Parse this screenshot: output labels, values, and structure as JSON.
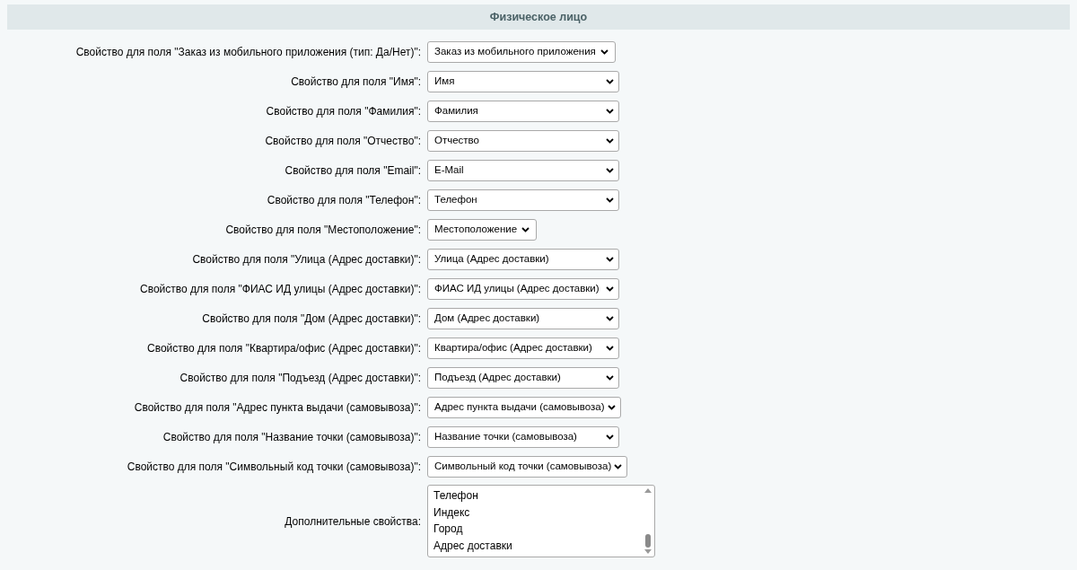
{
  "section": {
    "title": "Физическое лицо"
  },
  "fields": [
    {
      "label": "Свойство для поля \"Заказ из мобильного приложения (тип: Да/Нет)\":",
      "value": "Заказ из мобильного приложения",
      "kind": "fit"
    },
    {
      "label": "Свойство для поля \"Имя\":",
      "value": "Имя",
      "kind": "wide"
    },
    {
      "label": "Свойство для поля \"Фамилия\":",
      "value": "Фамилия",
      "kind": "wide"
    },
    {
      "label": "Свойство для поля \"Отчество\":",
      "value": "Отчество",
      "kind": "wide"
    },
    {
      "label": "Свойство для поля \"Email\":",
      "value": "E-Mail",
      "kind": "wide"
    },
    {
      "label": "Свойство для поля \"Телефон\":",
      "value": "Телефон",
      "kind": "wide"
    },
    {
      "label": "Свойство для поля \"Местоположение\":",
      "value": "Местоположение",
      "kind": "fit"
    },
    {
      "label": "Свойство для поля \"Улица (Адрес доставки)\":",
      "value": "Улица (Адрес доставки)",
      "kind": "wide"
    },
    {
      "label": "Свойство для поля \"ФИАС ИД улицы (Адрес доставки)\":",
      "value": "ФИАС ИД улицы (Адрес доставки)",
      "kind": "wide"
    },
    {
      "label": "Свойство для поля \"Дом (Адрес доставки)\":",
      "value": "Дом (Адрес доставки)",
      "kind": "wide"
    },
    {
      "label": "Свойство для поля \"Квартира/офис (Адрес доставки)\":",
      "value": "Квартира/офис (Адрес доставки)",
      "kind": "wide"
    },
    {
      "label": "Свойство для поля \"Подъезд (Адрес доставки)\":",
      "value": "Подъезд (Адрес доставки)",
      "kind": "wide"
    },
    {
      "label": "Свойство для поля \"Адрес пункта выдачи (самовывоза)\":",
      "value": "Адрес пункта выдачи (самовывоза)",
      "kind": "wide"
    },
    {
      "label": "Свойство для поля \"Название точки (самовывоза)\":",
      "value": "Название точки (самовывоза)",
      "kind": "wide"
    },
    {
      "label": "Свойство для поля \"Символьный код точки (самовывоза)\":",
      "value": "Символьный код точки (самовывоза)",
      "kind": "wide"
    }
  ],
  "extra": {
    "label": "Дополнительные свойства:",
    "options": [
      {
        "text": "Телефон",
        "selected": false
      },
      {
        "text": "Индекс",
        "selected": false
      },
      {
        "text": "Город",
        "selected": false
      },
      {
        "text": "Адрес доставки",
        "selected": false
      }
    ]
  }
}
